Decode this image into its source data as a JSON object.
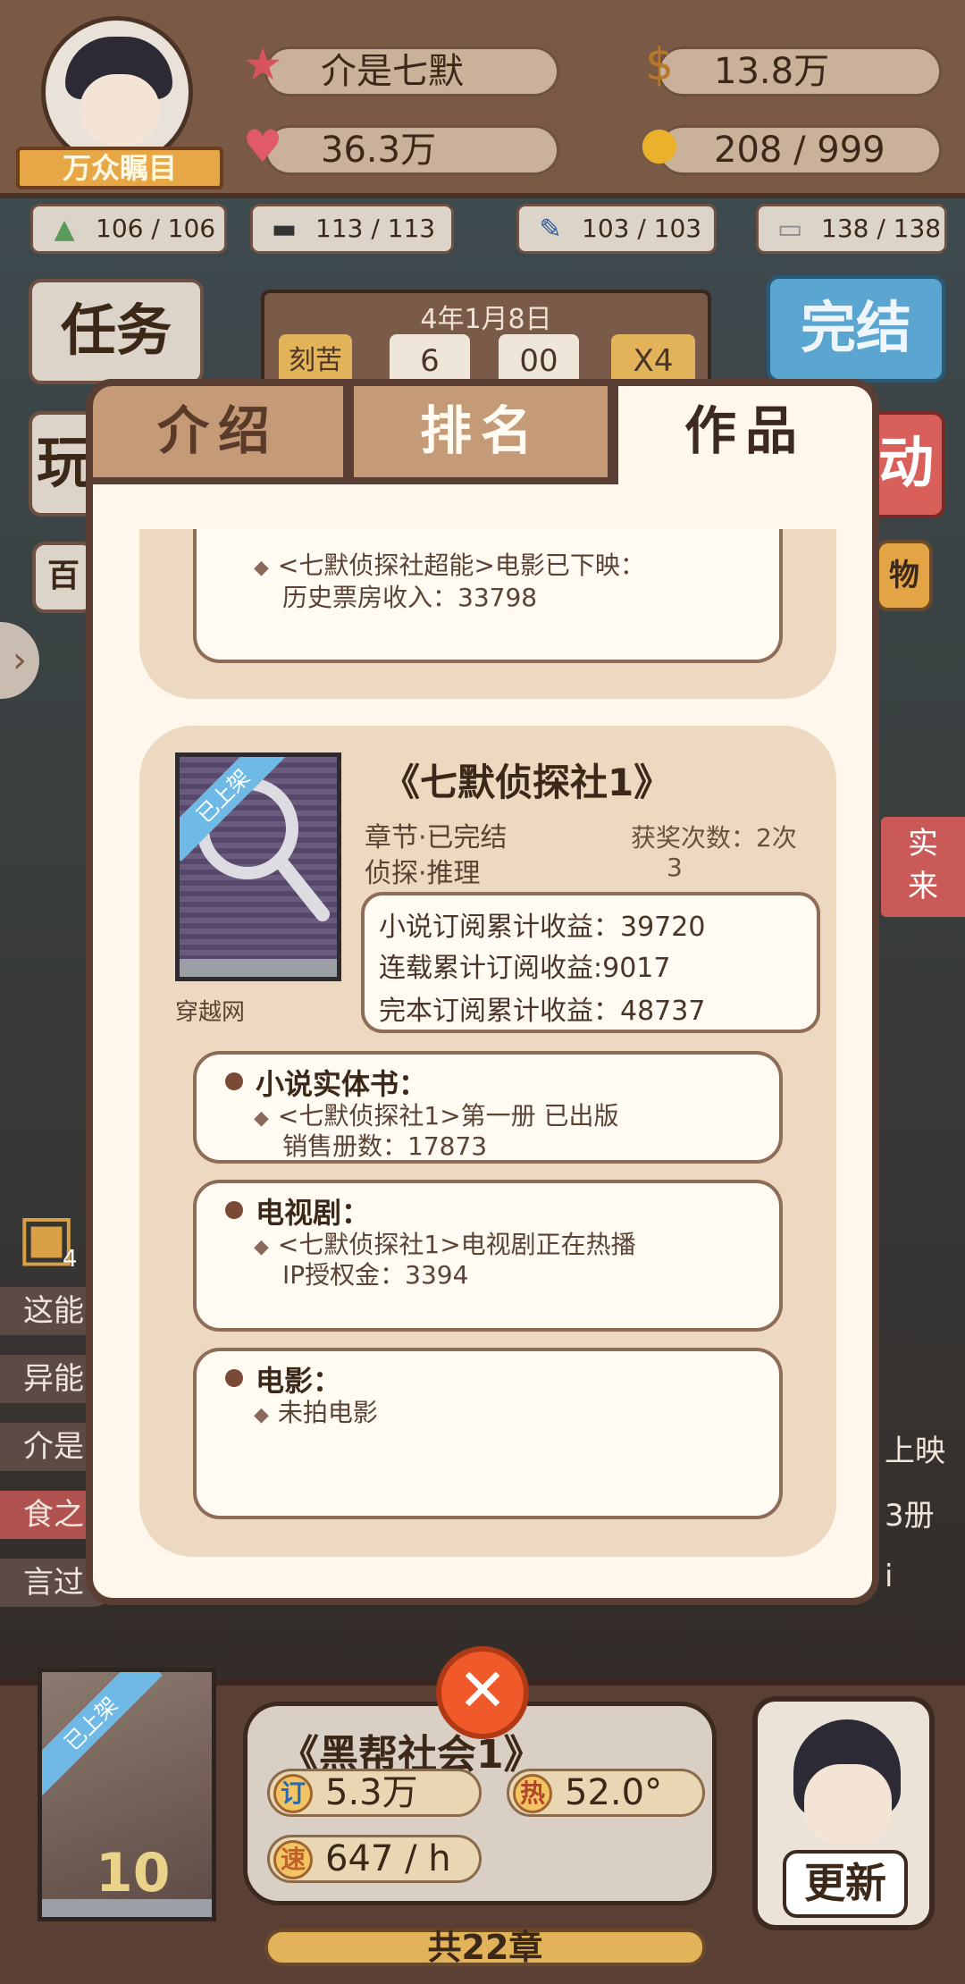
{
  "player": {
    "title_badge": "万众瞩目",
    "name": "介是七默",
    "fans": "36.3万",
    "money": "13.8万",
    "ideas": "208 / 999"
  },
  "resources": [
    {
      "icon": "mountain-icon",
      "value": "106 / 106"
    },
    {
      "icon": "hat-icon",
      "value": "113 / 113"
    },
    {
      "icon": "brush-icon",
      "value": "103 / 103"
    },
    {
      "icon": "book-icon",
      "value": "138 / 138"
    }
  ],
  "background": {
    "task_button": "任务",
    "finish_button": "完结",
    "play_button_partial": "玩",
    "activity_partial": "动",
    "hundred_partial": "百",
    "shop_partial": "物",
    "date": "4年1月8日",
    "hard_button": "刻苦",
    "time_h": "6",
    "time_m": "00",
    "speed": "X4",
    "side_badge": "实\n来",
    "rows": [
      "这能",
      "异能",
      "介是",
      "食之",
      "言过"
    ],
    "right_rows": [
      "上映",
      "3册",
      "i"
    ],
    "chest_count": "4"
  },
  "modal": {
    "tabs": [
      "介绍",
      "排名",
      "作品"
    ],
    "prev_card": {
      "line1": "<七默侦探社超能>电影已下映：",
      "line2": "历史票房收入：33798"
    },
    "book": {
      "cover_ribbon": "已上架",
      "title": "《七默侦探社1》",
      "status": "章节·已完结",
      "genre": "侦探·推理",
      "awards_label": "获奖次数：2次",
      "awards_sub": "3",
      "platform": "穿越网",
      "income": [
        "小说订阅累计收益：39720",
        "连载累计订阅收益:9017",
        "完本订阅累计收益：48737"
      ],
      "sections": [
        {
          "title": "小说实体书：",
          "lines": [
            "<七默侦探社1>第一册 已出版",
            "销售册数：17873"
          ]
        },
        {
          "title": "电视剧：",
          "lines": [
            "<七默侦探社1>电视剧正在热播",
            "IP授权金：3394"
          ]
        },
        {
          "title": "电影：",
          "lines": [
            "未拍电影"
          ]
        }
      ]
    }
  },
  "close_label": "✕",
  "current_book": {
    "ribbon": "已上架",
    "title": "《黑帮社会1》",
    "subs_badge": "订",
    "subs": "5.3万",
    "heat_badge": "热",
    "heat": "52.0°",
    "speed_badge": "速",
    "speed": "647 / h",
    "chapters": "共22章",
    "update_button": "更新",
    "cover_number": "10"
  },
  "colors": {
    "accent": "#f05a2a",
    "modal_bg": "#fff6ec",
    "card_bg": "#ecd9c0",
    "border": "#5a3d33"
  }
}
